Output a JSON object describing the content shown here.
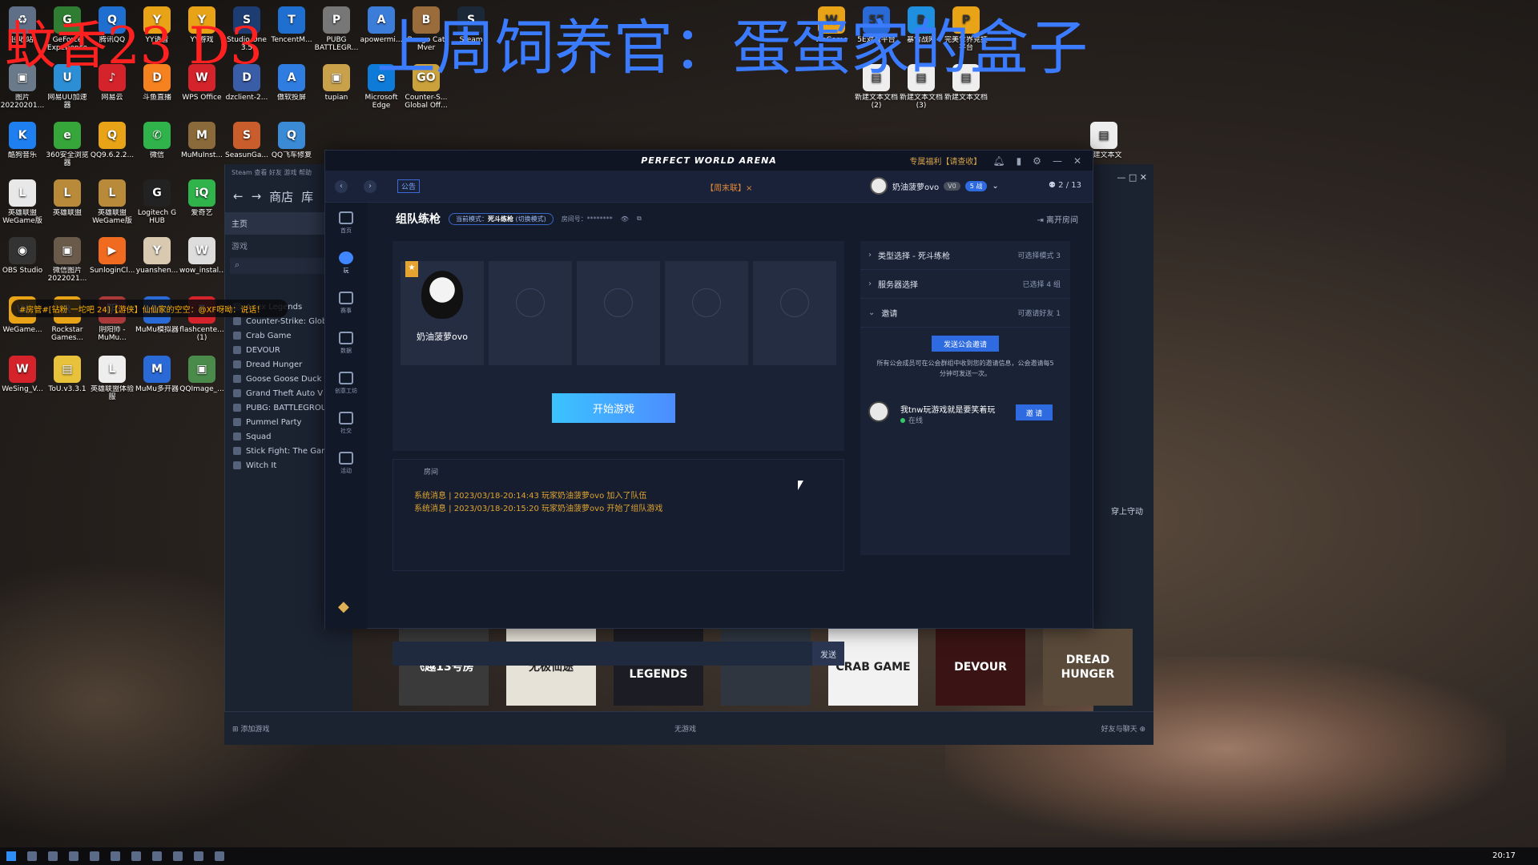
{
  "overlay": {
    "title_red": "蚊香23 D3",
    "title_blue": "上周饲养官：蛋蛋家的盒子",
    "chat_line": "#房管#[钻粉 一坨吧 24]【游侠】仙仙家的空空：@XF呀呦：说话！"
  },
  "desktop_icons": [
    {
      "label": "回收站",
      "color": "#5f6f88",
      "glyph": "♻"
    },
    {
      "label": "GeForce Experience",
      "color": "#2e7d32",
      "glyph": "G"
    },
    {
      "label": "腾讯QQ",
      "color": "#1f6fd0",
      "glyph": "Q"
    },
    {
      "label": "YY语音",
      "color": "#e8a317",
      "glyph": "Y"
    },
    {
      "label": "YY游戏",
      "color": "#e8a317",
      "glyph": "Y"
    },
    {
      "label": "Studio One 3.5",
      "color": "#1d3d72",
      "glyph": "S"
    },
    {
      "label": "TencentM...",
      "color": "#1f6fd0",
      "glyph": "T"
    },
    {
      "label": "PUBG BATTLEGR...",
      "color": "#777",
      "glyph": "P"
    },
    {
      "label": "apowermi...",
      "color": "#3c7dd9",
      "glyph": "A"
    },
    {
      "label": "Bongo Cat Mver",
      "color": "#9a6b3b",
      "glyph": "B"
    },
    {
      "label": "Steam",
      "color": "#1b2838",
      "glyph": "S"
    },
    {
      "label": "图片 20220201...",
      "color": "#6a7a8a",
      "glyph": "▣"
    },
    {
      "label": "网易UU加速器",
      "color": "#2c8fd6",
      "glyph": "U"
    },
    {
      "label": "网易云",
      "color": "#d4232b",
      "glyph": "♪"
    },
    {
      "label": "斗鱼直播",
      "color": "#f5821f",
      "glyph": "D"
    },
    {
      "label": "WPS Office",
      "color": "#d4232b",
      "glyph": "W"
    },
    {
      "label": "dzclient-2...",
      "color": "#3a5da8",
      "glyph": "D"
    },
    {
      "label": "傲软投屏",
      "color": "#2f7de0",
      "glyph": "A"
    },
    {
      "label": "tupian",
      "color": "#c9a14b",
      "glyph": "▣"
    },
    {
      "label": "Microsoft Edge",
      "color": "#0f7bd8",
      "glyph": "e"
    },
    {
      "label": "Counter-S... Global Off...",
      "color": "#caa13a",
      "glyph": "GO"
    },
    {
      "label": "酷狗音乐",
      "color": "#1d7ff0",
      "glyph": "K"
    },
    {
      "label": "360安全浏览器",
      "color": "#36a53a",
      "glyph": "e"
    },
    {
      "label": "QQ9.6.2.2...",
      "color": "#e8a317",
      "glyph": "Q"
    },
    {
      "label": "微信",
      "color": "#2fb34a",
      "glyph": "✆"
    },
    {
      "label": "MuMuInst...",
      "color": "#8a6a3a",
      "glyph": "M"
    },
    {
      "label": "SeasunGa...",
      "color": "#c95d2b",
      "glyph": "S"
    },
    {
      "label": "QQ飞车修复",
      "color": "#3a8ad6",
      "glyph": "Q"
    },
    {
      "label": "英雄联盟 WeGame版",
      "color": "#e8e8e8",
      "glyph": "L"
    },
    {
      "label": "英雄联盟",
      "color": "#b98a3a",
      "glyph": "L"
    },
    {
      "label": "英雄联盟 WeGame版",
      "color": "#b98a3a",
      "glyph": "L"
    },
    {
      "label": "Logitech G HUB",
      "color": "#222",
      "glyph": "G"
    },
    {
      "label": "爱奇艺",
      "color": "#2fb34a",
      "glyph": "iQ"
    },
    {
      "label": "OBS Studio",
      "color": "#333",
      "glyph": "◉"
    },
    {
      "label": "微信图片 2022021...",
      "color": "#6a5a4a",
      "glyph": "▣"
    },
    {
      "label": "SunloginCl...",
      "color": "#f06a1f",
      "glyph": "▶"
    },
    {
      "label": "yuanshen...",
      "color": "#d8c9b0",
      "glyph": "Y"
    },
    {
      "label": "wow_instal...",
      "color": "#ddd",
      "glyph": "W"
    },
    {
      "label": "WeGame...",
      "color": "#e8a317",
      "glyph": "W"
    },
    {
      "label": "Rockstar Games...",
      "color": "#e8a317",
      "glyph": "R"
    },
    {
      "label": "阴阳师 -MuMu...",
      "color": "#aa3a3a",
      "glyph": "阴"
    },
    {
      "label": "MuMu模拟器",
      "color": "#2a6ad6",
      "glyph": "M"
    },
    {
      "label": "flashcente... (1)",
      "color": "#d4232b",
      "glyph": "F"
    },
    {
      "label": "WeSing_V...",
      "color": "#d4232b",
      "glyph": "W"
    },
    {
      "label": "ToU.v3.3.1",
      "color": "#e8c23a",
      "glyph": "▤"
    },
    {
      "label": "英雄联盟体验服",
      "color": "#eee",
      "glyph": "L"
    },
    {
      "label": "MuMu多开器",
      "color": "#2a6ad6",
      "glyph": "M"
    },
    {
      "label": "QQImage_...",
      "color": "#4a8a4a",
      "glyph": "▣"
    }
  ],
  "desktop_icons_right": [
    {
      "label": "WeGame",
      "color": "#e8a317",
      "glyph": "W"
    },
    {
      "label": "5E对战平台",
      "color": "#2a6ad6",
      "glyph": "5E"
    },
    {
      "label": "暴雪战网",
      "color": "#1f8fe0",
      "glyph": "B"
    },
    {
      "label": "完美世界竞技平台",
      "color": "#e8a317",
      "glyph": "P"
    },
    {
      "label": "新建文本文档(2)",
      "color": "#eee",
      "glyph": "▤"
    },
    {
      "label": "新建文本文档(3)",
      "color": "#eee",
      "glyph": "▤"
    },
    {
      "label": "新建文本文档",
      "color": "#eee",
      "glyph": "▤"
    },
    {
      "label": "新建文本文",
      "color": "#eee",
      "glyph": "▤"
    }
  ],
  "steam": {
    "topnav": "Steam  查看  好友  游戏  帮助",
    "store": "商店",
    "library": "库",
    "home": "主页",
    "games_section": "游戏",
    "search_icon": "search-icon",
    "games": [
      "Apex Legends",
      "Counter-Strike: Global",
      "Crab Game",
      "DEVOUR",
      "Dread Hunger",
      "Goose Goose Duck",
      "Grand Theft Auto V",
      "PUBG: BATTLEGROU",
      "Pummel Party",
      "Squad",
      "Stick Fight: The Gam",
      "Witch It"
    ],
    "add_game": "添加游戏",
    "center_status": "无游戏",
    "friends_chat": "好友与聊天",
    "right_label": "穿上守动"
  },
  "game_tiles": [
    {
      "title": "飞越13号房",
      "bg": "#3a3a3a"
    },
    {
      "title": "无极仙途",
      "bg": "#e6e2d8"
    },
    {
      "title": "APEX LEGENDS",
      "bg": "#1c1c24"
    },
    {
      "title": "",
      "bg": "#2f3640"
    },
    {
      "title": "CRAB GAME",
      "bg": "#f2f2f2"
    },
    {
      "title": "DEVOUR",
      "bg": "#3a1414"
    },
    {
      "title": "DREAD HUNGER",
      "bg": "#5a4a3a"
    }
  ],
  "pwa": {
    "brand": "PERFECT WORLD ARENA",
    "promo": "专属福利【请查收】",
    "notice": "公告",
    "center_tab": "【周末联】×",
    "username": "奶油菠萝ovo",
    "vip": "V0",
    "tag": "5 战",
    "count": "2 / 13",
    "sidebar": [
      {
        "label": "首页",
        "icon": "home-icon"
      },
      {
        "label": "玩",
        "icon": "play-icon",
        "active": true
      },
      {
        "label": "赛事",
        "icon": "trophy-icon"
      },
      {
        "label": "数据",
        "icon": "data-icon"
      },
      {
        "label": "创意工坊",
        "icon": "workshop-icon"
      },
      {
        "label": "社交",
        "icon": "social-icon"
      },
      {
        "label": "活动",
        "icon": "gift-icon"
      }
    ],
    "room": {
      "title": "组队练枪",
      "mode_label": "当前模式：",
      "mode_value": "死斗练枪",
      "mode_switch": "(切换模式)",
      "room_no_label": "房间号：********",
      "leave": "离开房间"
    },
    "members": [
      {
        "name": "奶油菠萝ovo",
        "captain": true
      }
    ],
    "empty_slots": 4,
    "start_button": "开始游戏",
    "chat": {
      "tab": "房间",
      "messages": [
        "系统消息 | 2023/03/18-20:14:43 玩家奶油菠萝ovo 加入了队伍",
        "系统消息 | 2023/03/18-20:15:20 玩家奶油菠萝ovo 开始了组队游戏"
      ],
      "input_placeholder": "",
      "send": "发送"
    },
    "right": {
      "type_select": "类型选择 - 死斗练枪",
      "type_meta": "可选择模式 3",
      "server_select": "服务器选择",
      "server_meta": "已选择 4 组",
      "invite": "邀请",
      "invite_meta": "可邀请好友 1",
      "guild_button": "发送公会邀请",
      "guild_note": "所有公会成员可在公会群组中收到您的邀请信息，公会邀请每5分钟可发送一次。",
      "friend_name": "我tnw玩游戏就是要笑着玩",
      "friend_status": "在线",
      "invite_button": "邀 请"
    }
  },
  "taskbar": {
    "clock": "20:17"
  }
}
